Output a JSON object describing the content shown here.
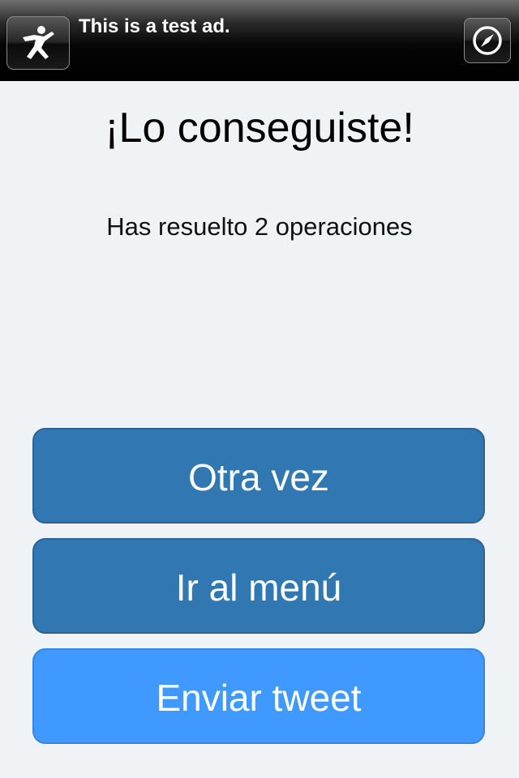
{
  "ad": {
    "logo_icon": "running-figure-icon",
    "text": "This is a test ad.",
    "action_icon": "compass-icon"
  },
  "result": {
    "title": "¡Lo conseguiste!",
    "message": "Has resuelto 2 operaciones"
  },
  "buttons": {
    "again": "Otra vez",
    "menu": "Ir al menú",
    "tweet": "Enviar tweet"
  },
  "colors": {
    "background": "#eff3f6",
    "button_primary": "#3177b2",
    "button_tweet": "#3f99fe"
  }
}
